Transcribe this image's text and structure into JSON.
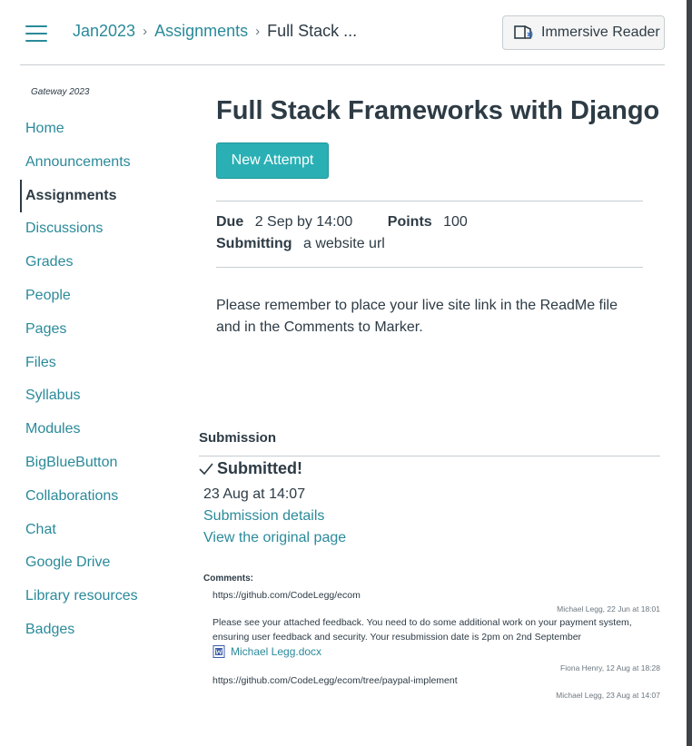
{
  "breadcrumb": {
    "items": [
      "Jan2023",
      "Assignments"
    ],
    "current": "Full Stack ...",
    "separator": ">"
  },
  "immersive_reader": {
    "label": "Immersive Reader",
    "icon": "immersive-reader-icon"
  },
  "sidebar": {
    "course_name": "Gateway 2023",
    "active": "Assignments",
    "items": [
      {
        "label": "Home"
      },
      {
        "label": "Announcements"
      },
      {
        "label": "Assignments"
      },
      {
        "label": "Discussions"
      },
      {
        "label": "Grades"
      },
      {
        "label": "People"
      },
      {
        "label": "Pages"
      },
      {
        "label": "Files"
      },
      {
        "label": "Syllabus"
      },
      {
        "label": "Modules"
      },
      {
        "label": "BigBlueButton"
      },
      {
        "label": "Collaborations"
      },
      {
        "label": "Chat"
      },
      {
        "label": "Google Drive"
      },
      {
        "label": "Library resources"
      },
      {
        "label": "Badges"
      }
    ]
  },
  "assignment": {
    "title": "Full Stack Frameworks with Django",
    "new_attempt_label": "New Attempt",
    "due_label": "Due",
    "due_value": "2 Sep by 14:00",
    "points_label": "Points",
    "points_value": "100",
    "submitting_label": "Submitting",
    "submitting_value": "a website url",
    "description": "Please remember to place your live site link in the ReadMe file and in the Comments to Marker."
  },
  "submission": {
    "heading": "Submission",
    "status": "Submitted!",
    "date": "23 Aug at 14:07",
    "details_link": "Submission details",
    "original_link": "View the original page",
    "comments_label": "Comments:",
    "comments": [
      {
        "text": "https://github.com/CodeLegg/ecom",
        "meta": "Michael Legg, 22 Jun at 18:01"
      },
      {
        "text": "Please see your attached feedback. You need to do some additional work on your payment system, ensuring user feedback and security. Your resubmission date is 2pm on 2nd September",
        "attachment": "Michael Legg.docx",
        "meta": "Fiona Henry, 12 Aug at 18:28"
      },
      {
        "text": "https://github.com/CodeLegg/ecom/tree/paypal-implement",
        "meta": "Michael Legg, 23 Aug at 14:07"
      }
    ]
  },
  "colors": {
    "link": "#2a8a9a",
    "text": "#2d3b45",
    "button": "#2ab0b4",
    "rule": "#c7cdd1"
  }
}
